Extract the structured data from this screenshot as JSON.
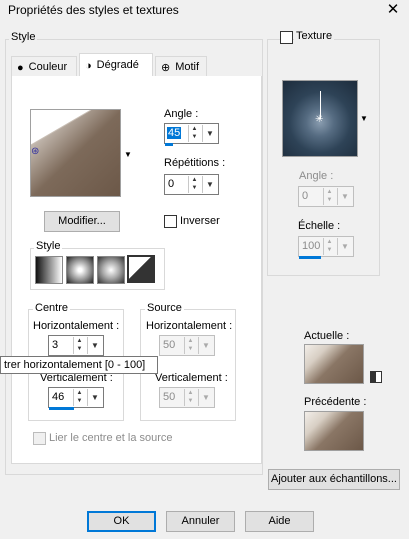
{
  "window": {
    "title": "Propriétés des styles et textures",
    "close_glyph": "✕"
  },
  "style_group": {
    "label": "Style"
  },
  "tabs": [
    {
      "label": "Couleur",
      "icon": "filled-circle-icon",
      "glyph": "●"
    },
    {
      "label": "Dégradé",
      "icon": "half-circle-icon",
      "glyph": "◑"
    },
    {
      "label": "Motif",
      "icon": "pattern-icon",
      "glyph": "⊕"
    }
  ],
  "gradient": {
    "angle_label": "Angle :",
    "angle_value": "45",
    "repeats_label": "Répétitions :",
    "repeats_value": "0",
    "modify_label": "Modifier...",
    "invert_label": "Inverser",
    "style_label": "Style",
    "style_options": [
      "linear-style-icon",
      "rectangular-style-icon",
      "sunburst-style-icon",
      "radial-style-icon"
    ],
    "active_style_index": 3
  },
  "center": {
    "label": "Centre",
    "h_label": "Horizontalement :",
    "h_value": "3",
    "v_label": "Verticalement :",
    "v_value": "46"
  },
  "source": {
    "label": "Source",
    "h_label": "Horizontalement :",
    "h_value": "50",
    "v_label": "Verticalement :",
    "v_value": "50"
  },
  "link_label": "Lier le centre et la source",
  "tooltip": "trer horizontalement [0 - 100]",
  "texture": {
    "label": "Texture",
    "angle_label": "Angle :",
    "angle_value": "0",
    "scale_label": "Échelle :",
    "scale_value": "100"
  },
  "current_label": "Actuelle :",
  "previous_label": "Précédente :",
  "add_swatches_label": "Ajouter aux échantillons...",
  "buttons": {
    "ok": "OK",
    "cancel": "Annuler",
    "help": "Aide"
  },
  "colors": {
    "accent": "#0078d7",
    "gradient_start": "#f2eee9",
    "gradient_end": "#6c5848"
  }
}
